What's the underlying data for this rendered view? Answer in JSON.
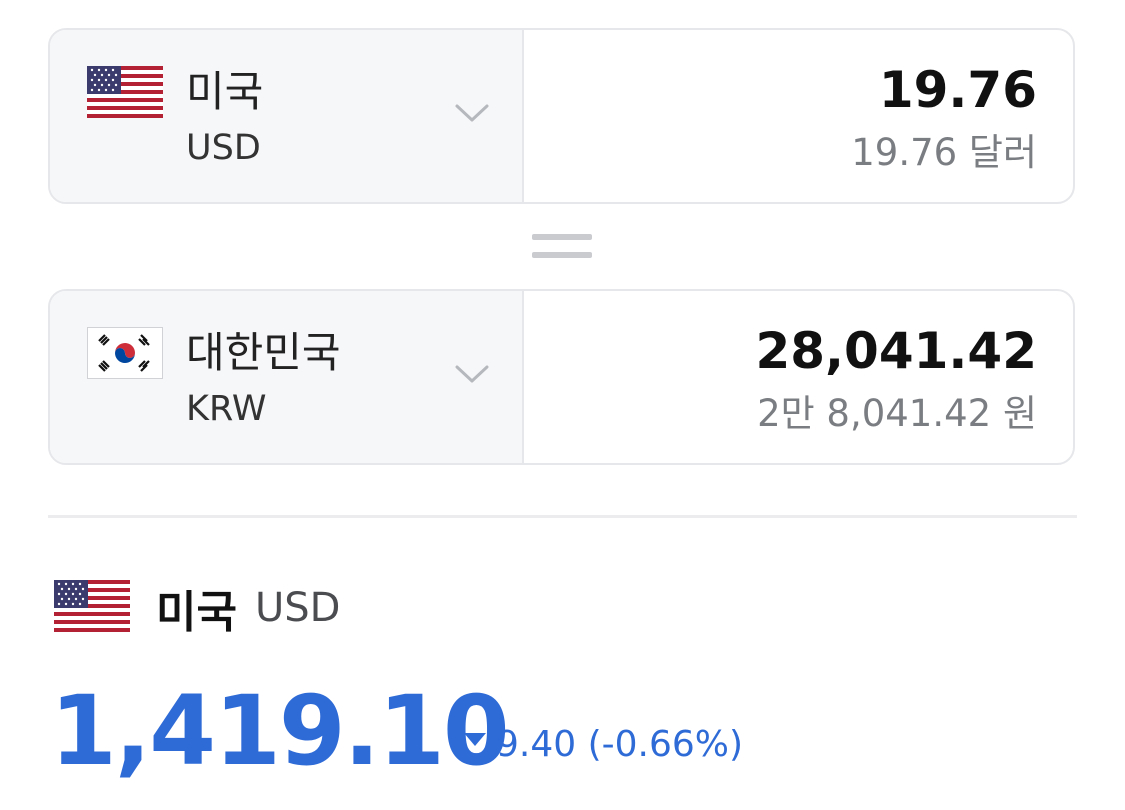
{
  "converter": {
    "from": {
      "country": "미국",
      "code": "USD",
      "amount": "19.76",
      "amount_words": "19.76 달러",
      "flag_icon": "us-flag-icon"
    },
    "to": {
      "country": "대한민국",
      "code": "KRW",
      "amount": "28,041.42",
      "amount_words": "2만 8,041.42 원",
      "flag_icon": "kr-flag-icon"
    },
    "equals_icon": "equals-icon",
    "dropdown_icon": "chevron-down-icon"
  },
  "rate": {
    "country": "미국",
    "code": "USD",
    "value": "1,419.10",
    "change": "9.40 (-0.66%)",
    "direction_icon": "down-triangle-icon",
    "color": "#2f6bd7"
  }
}
